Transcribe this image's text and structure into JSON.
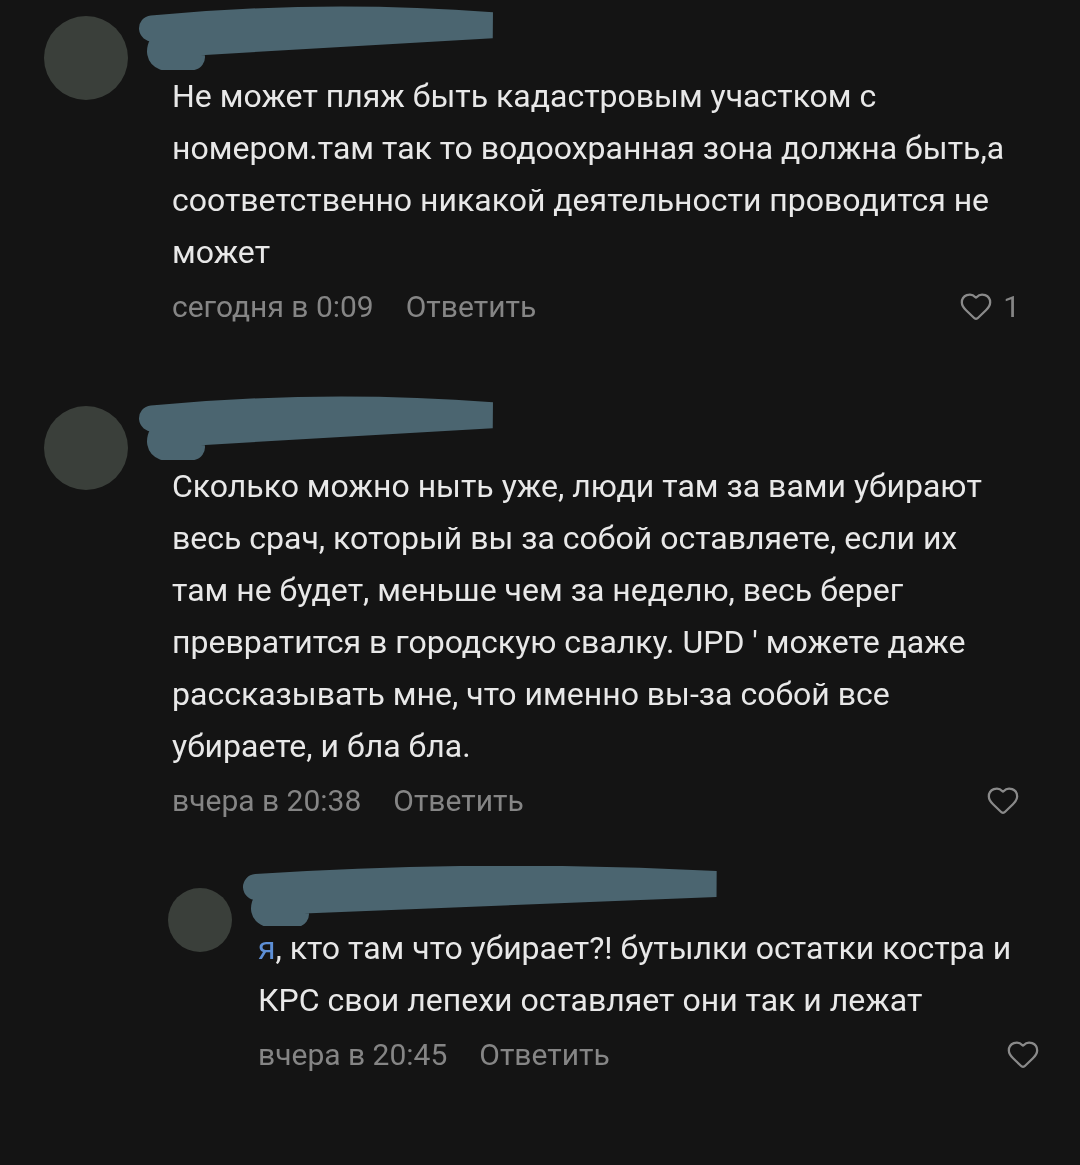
{
  "comments": [
    {
      "text": "Не может пляж быть кадастровым участком с номером.там так то водоохранная зона должна быть,а соответственно никакой деятельности проводится не может",
      "time": "сегодня в 0:09",
      "reply": "Ответить",
      "likes": "1",
      "liked": false
    },
    {
      "text": "Сколько можно ныть уже, люди там за вами убирают весь срач, который вы за собой оставляете, если их там не будет, меньше чем за неделю, весь берег превратится в городскую свалку. UPD ' можете даже рассказывать мне, что именно вы-за собой все убираете, и бла бла.",
      "time": "вчера в 20:38",
      "reply": "Ответить",
      "liked": false,
      "replies": [
        {
          "mention": "я",
          "text": ", кто там что убирает?! бутылки остатки костра и КРС свои лепехи оставляет они так и лежат",
          "time": "вчера в 20:45",
          "reply": "Ответить",
          "liked": false
        }
      ]
    }
  ]
}
